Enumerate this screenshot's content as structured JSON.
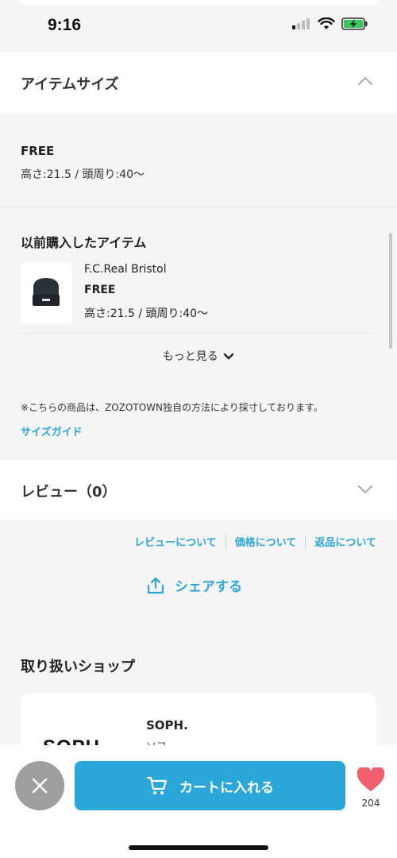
{
  "status_bar": {
    "time": "9:16"
  },
  "item_size": {
    "title": "アイテムサイズ",
    "size": "FREE",
    "spec": "高さ:21.5 / 頭周り:40～"
  },
  "previous_items": {
    "title": "以前購入したアイテム",
    "item": {
      "brand": "F.C.Real Bristol",
      "size": "FREE",
      "spec": "高さ:21.5 / 頭周り:40～"
    },
    "more_label": "もっと見る"
  },
  "note": "※こちらの商品は、ZOZOTOWN独自の方法により採寸しております。",
  "size_guide_label": "サイズガイド",
  "review": {
    "title": "レビュー（0）"
  },
  "links": {
    "review_about": "レビューについて",
    "price_about": "価格について",
    "return_about": "返品について"
  },
  "share_label": "シェアする",
  "shop": {
    "heading": "取り扱いショップ",
    "name": "SOPH.",
    "sub": "ソフ",
    "logo_text": "SOPH."
  },
  "bottom_bar": {
    "cart_label": "カートに入れる",
    "favorite_count": "204"
  },
  "colors": {
    "accent": "#2aa6d8",
    "favorite": "#f0606e",
    "close_button": "#9e9e9e"
  }
}
